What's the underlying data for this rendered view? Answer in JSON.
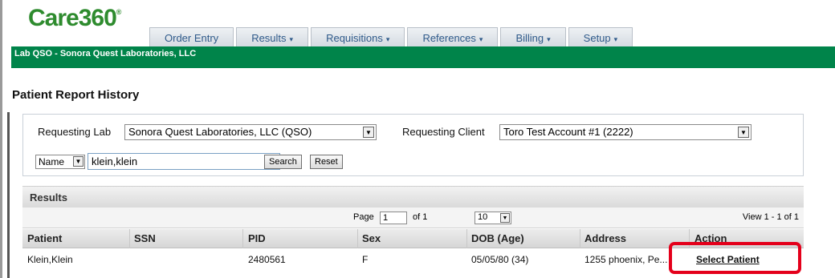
{
  "app": {
    "logo_text": "Care360",
    "logo_mark": "®",
    "org_bar": "Lab QSO - Sonora Quest Laboratories, LLC"
  },
  "nav": {
    "tabs": [
      {
        "label": "Order Entry",
        "has_menu": false
      },
      {
        "label": "Results",
        "has_menu": true
      },
      {
        "label": "Requisitions",
        "has_menu": true
      },
      {
        "label": "References",
        "has_menu": true
      },
      {
        "label": "Billing",
        "has_menu": true
      },
      {
        "label": "Setup",
        "has_menu": true
      }
    ],
    "caret": "▾"
  },
  "page": {
    "title": "Patient Report History"
  },
  "search": {
    "requesting_lab_label": "Requesting Lab",
    "requesting_lab_value": "Sonora Quest Laboratories, LLC (QSO)",
    "requesting_client_label": "Requesting Client",
    "requesting_client_value": "Toro Test Account #1 (2222)",
    "field_type_value": "Name",
    "query_value": "klein,klein",
    "search_button": "Search",
    "reset_button": "Reset"
  },
  "results": {
    "heading": "Results",
    "page_label": "Page",
    "page_value": "1",
    "of_label": "of 1",
    "rows_per_page": "10",
    "view_text": "View 1 - 1 of 1",
    "columns": [
      "Patient",
      "SSN",
      "PID",
      "Sex",
      "DOB (Age)",
      "Address",
      "Action"
    ],
    "rows": [
      {
        "patient": "Klein,Klein",
        "ssn": "",
        "pid": "2480561",
        "sex": "F",
        "dob": "05/05/80 (34)",
        "address": "1255 phoenix, Pe...",
        "action": "Select Patient"
      }
    ]
  },
  "colors": {
    "brand_green": "#00844a",
    "highlight_red": "#e4001b",
    "tab_text": "#2f5a8a"
  }
}
